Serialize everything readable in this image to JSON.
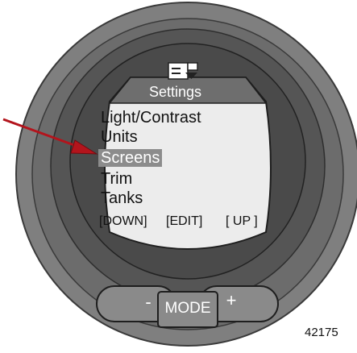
{
  "screen": {
    "header_icon": "menu-dropdown-icon",
    "title": "Settings"
  },
  "menu": {
    "items": [
      {
        "label": "Light/Contrast",
        "selected": false
      },
      {
        "label": "Units",
        "selected": false
      },
      {
        "label": "Screens",
        "selected": true
      },
      {
        "label": "Trim",
        "selected": false
      },
      {
        "label": "Tanks",
        "selected": false
      }
    ]
  },
  "softkeys": {
    "left": "[DOWN]",
    "center": "[EDIT]",
    "right": "[ UP ]"
  },
  "buttons": {
    "minus": "-",
    "mode": "MODE",
    "plus": "+"
  },
  "pointer_arrow": {
    "color": "#b3141c",
    "target": "Screens"
  },
  "figure_number": "42175",
  "colors": {
    "bezel_outer": "#7f7f7f",
    "bezel_ring": "#5c5c5c",
    "screen_bg": "#ececec",
    "header_bg": "#6e6e6e",
    "selection_bg": "#8c8c8c",
    "button_bg": "#8a8a8a"
  }
}
